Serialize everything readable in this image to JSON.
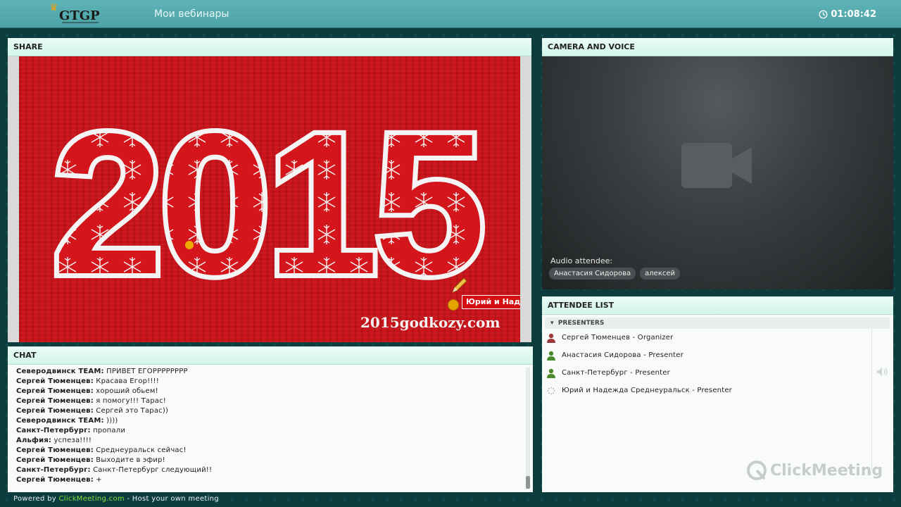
{
  "header": {
    "logo_text": "GTGP",
    "nav_label": "Мои вебинары",
    "timer": "01:08:42"
  },
  "share": {
    "title": "SHARE",
    "slide_year": "2015",
    "slide_site": "2015godkozy.com",
    "cursor_label": "Юрий и Надежда"
  },
  "camera": {
    "title": "CAMERA AND VOICE",
    "audio_label": "Audio attendee:",
    "audio_attendees": [
      "Анастасия Сидорова",
      "алексей"
    ]
  },
  "chat": {
    "title": "CHAT",
    "messages": [
      {
        "author": "Северодвинск TEAM:",
        "text": " ПРИВЕТ ЕГОРРРРРРРР"
      },
      {
        "author": "Сергей Тюменцев:",
        "text": " Красава Егор!!!!"
      },
      {
        "author": "Сергей Тюменцев:",
        "text": " хороший обьем!"
      },
      {
        "author": "Сергей Тюменцев:",
        "text": " я помогу!!! Тарас!"
      },
      {
        "author": "Сергей Тюменцев:",
        "text": " Сергей это Тарас))"
      },
      {
        "author": "Северодвинск TEAM:",
        "text": " ))))"
      },
      {
        "author": "Санкт-Петербург:",
        "text": " пропали"
      },
      {
        "author": "Альфия:",
        "text": " успеза!!!!"
      },
      {
        "author": "Сергей Тюменцев:",
        "text": " Среднеуральск сейчас!"
      },
      {
        "author": "Сергей Тюменцев:",
        "text": " Выходите в эфир!"
      },
      {
        "author": "Санкт-Петербург:",
        "text": " Санкт-Петербург следующий!!"
      },
      {
        "author": "Сергей Тюменцев:",
        "text": " +"
      }
    ]
  },
  "attendees": {
    "title": "ATTENDEE LIST",
    "section_label": "PRESENTERS",
    "items": [
      {
        "name": "Сергей Тюменцев - Organizer",
        "icon": "user-icon",
        "color": "#9b3a3a"
      },
      {
        "name": "Анастасия Сидорова - Presenter",
        "icon": "user-icon",
        "color": "#4a8a2c"
      },
      {
        "name": "Санкт-Петербург - Presenter",
        "icon": "user-icon",
        "color": "#4a8a2c"
      },
      {
        "name": "Юрий и Надежда Среднеуральск - Presenter",
        "icon": "loading-icon",
        "color": "#bbbbbb"
      }
    ],
    "watermark": "ClickMeeting"
  },
  "footer": {
    "prefix": "Powered by ",
    "link": "ClickMeeting.com",
    "suffix": " - Host your own meeting"
  },
  "colors": {
    "topbar": "#4ca3a7",
    "slide_red": "#c8141a",
    "footer_link": "#7fe03b"
  }
}
